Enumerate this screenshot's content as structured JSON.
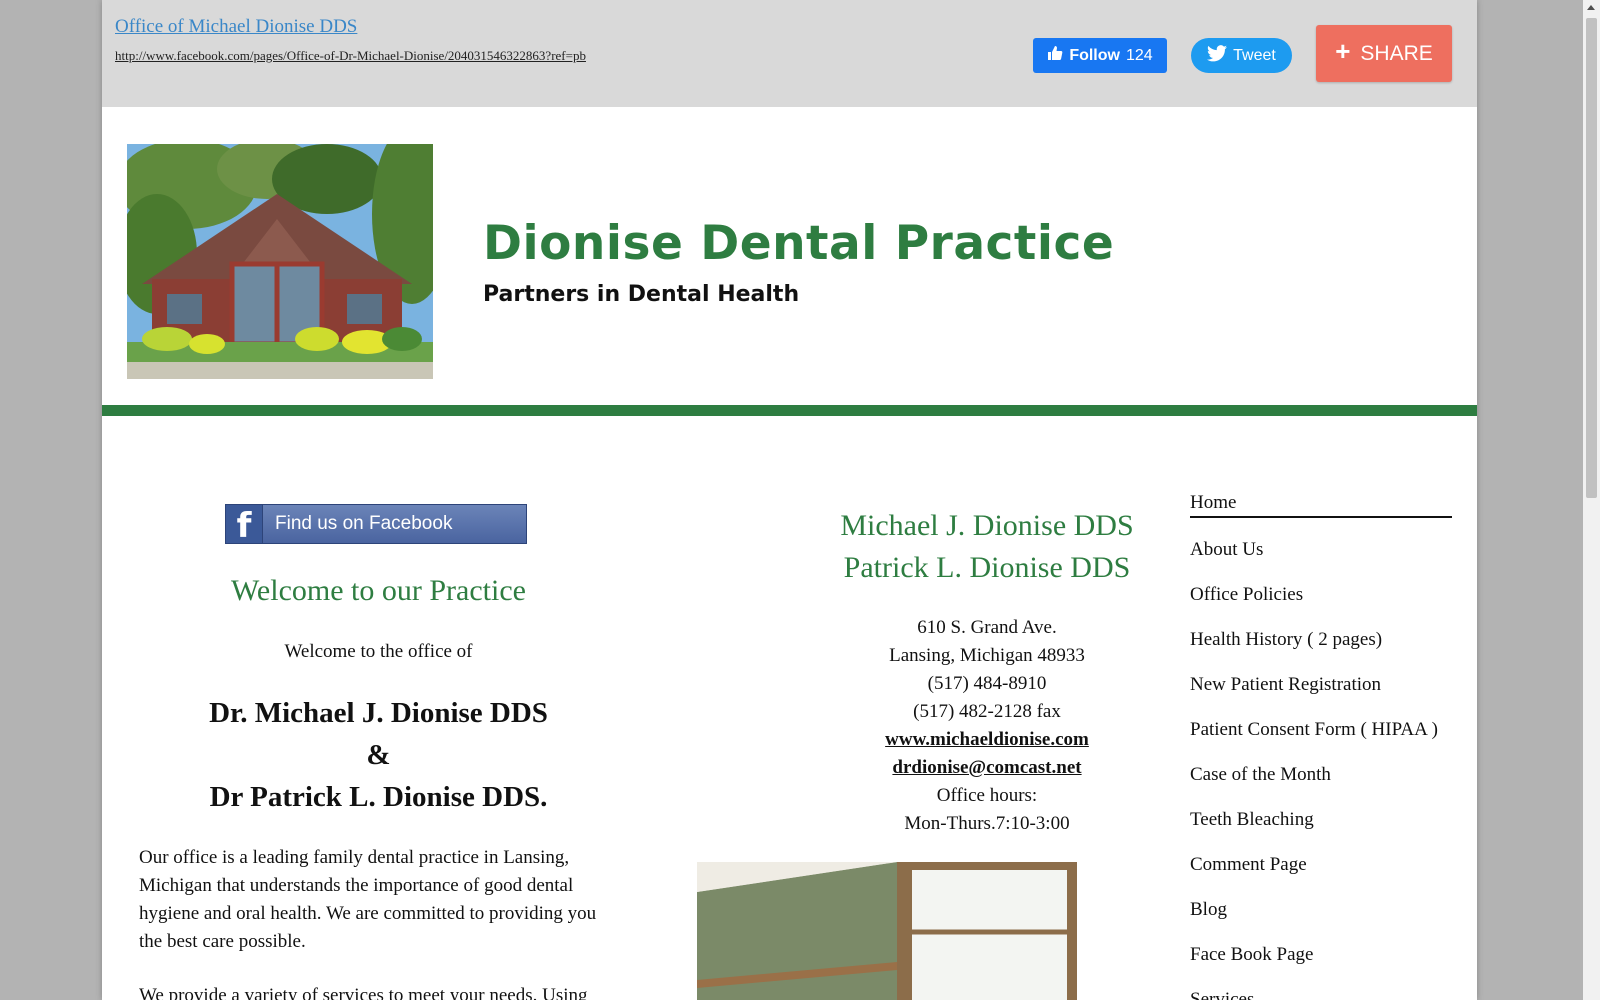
{
  "social_bar": {
    "page_link": "Office of Michael Dionise DDS",
    "page_url": "http://www.facebook.com/pages/Office-of-Dr-Michael-Dionise/204031546322863?ref=pb",
    "follow_label": "Follow",
    "follow_count": "124",
    "tweet_label": "Tweet",
    "share_label": "SHARE"
  },
  "header": {
    "title": "Dionise Dental Practice",
    "tagline": "Partners in Dental Health"
  },
  "left": {
    "facebook_button": "Find us on Facebook",
    "welcome_heading": "Welcome to our Practice",
    "welcome_sub": "Welcome to the office of",
    "doctor_1": "Dr. Michael J. Dionise DDS",
    "ampersand": "&",
    "doctor_2": "Dr Patrick L. Dionise DDS.",
    "paragraph_1": "Our office is a leading family dental practice in Lansing, Michigan that understands the importance of good dental hygiene and oral health. We are committed to providing you the best care possible.",
    "paragraph_2": "We provide a variety of services to meet your needs. Using"
  },
  "center": {
    "name_1": "Michael J. Dionise DDS",
    "name_2": "Patrick L. Dionise DDS",
    "address_1": "610 S. Grand Ave.",
    "address_2": "Lansing, Michigan 48933",
    "phone": "(517) 484-8910",
    "fax": "(517) 482-2128 fax",
    "website": "www.michaeldionise.com",
    "email": "drdionise@comcast.net",
    "hours_label": "Office hours:",
    "hours": "Mon-Thurs.7:10-3:00"
  },
  "nav": {
    "items": [
      {
        "label": "Home"
      },
      {
        "label": "About Us"
      },
      {
        "label": "Office Policies"
      },
      {
        "label": "Health History ( 2 pages)"
      },
      {
        "label": "New Patient Registration"
      },
      {
        "label": "Patient Consent Form ( HIPAA )"
      },
      {
        "label": "Case of the Month"
      },
      {
        "label": "Teeth Bleaching"
      },
      {
        "label": "Comment Page"
      },
      {
        "label": "Blog"
      },
      {
        "label": "Face Book Page"
      },
      {
        "label": "Services"
      }
    ]
  },
  "colors": {
    "brand_green": "#2e7d41",
    "facebook_blue": "#1877f2",
    "twitter_blue": "#1d9bf0",
    "share_coral": "#ee6f5f"
  }
}
